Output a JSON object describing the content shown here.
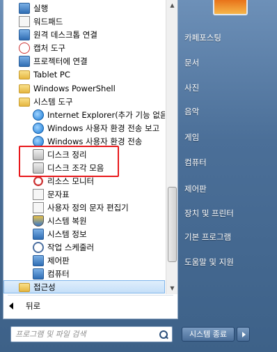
{
  "programs": [
    {
      "label": "실행",
      "icon": "run-icon"
    },
    {
      "label": "워드패드",
      "icon": "wordpad-icon"
    },
    {
      "label": "원격 데스크톱 연결",
      "icon": "remote-desktop-icon"
    },
    {
      "label": "캡처 도구",
      "icon": "snipping-tool-icon"
    },
    {
      "label": "프로젝터에 연결",
      "icon": "projector-icon"
    },
    {
      "label": "Tablet PC",
      "icon": "folder-icon"
    },
    {
      "label": "Windows PowerShell",
      "icon": "folder-icon"
    },
    {
      "label": "시스템 도구",
      "icon": "folder-icon"
    },
    {
      "label": "Internet Explorer(추가 기능 없음",
      "icon": "internet-explorer-icon"
    },
    {
      "label": "Windows 사용자 환경 전송 보고",
      "icon": "easy-transfer-report-icon"
    },
    {
      "label": "Windows 사용자 환경 전송",
      "icon": "easy-transfer-icon"
    },
    {
      "label": "디스크 정리",
      "icon": "disk-cleanup-icon"
    },
    {
      "label": "디스크 조각 모음",
      "icon": "disk-defragmenter-icon"
    },
    {
      "label": "리소스 모니터",
      "icon": "resource-monitor-icon"
    },
    {
      "label": "문자표",
      "icon": "character-map-icon"
    },
    {
      "label": "사용자 정의 문자 편집기",
      "icon": "private-character-editor-icon"
    },
    {
      "label": "시스템 복원",
      "icon": "system-restore-icon"
    },
    {
      "label": "시스템 정보",
      "icon": "system-information-icon"
    },
    {
      "label": "작업 스케줄러",
      "icon": "task-scheduler-icon"
    },
    {
      "label": "제어판",
      "icon": "control-panel-icon"
    },
    {
      "label": "컴퓨터",
      "icon": "computer-icon"
    },
    {
      "label": "접근성",
      "icon": "folder-icon"
    }
  ],
  "back_label": "뒤로",
  "search_placeholder": "프로그램 및 파일 검색",
  "right_menu": [
    {
      "label": "카페포스팅"
    },
    {
      "label": "문서"
    },
    {
      "label": "사진"
    },
    {
      "label": "음악"
    },
    {
      "label": "게임"
    },
    {
      "label": "컴퓨터"
    },
    {
      "label": "제어판"
    },
    {
      "label": "장치 및 프린터"
    },
    {
      "label": "기본 프로그램"
    },
    {
      "label": "도움말 및 지원"
    }
  ],
  "shutdown_label": "시스템 종료",
  "colors": {
    "highlight_box": "#e8171a",
    "selected_row": "#c5dff8"
  }
}
